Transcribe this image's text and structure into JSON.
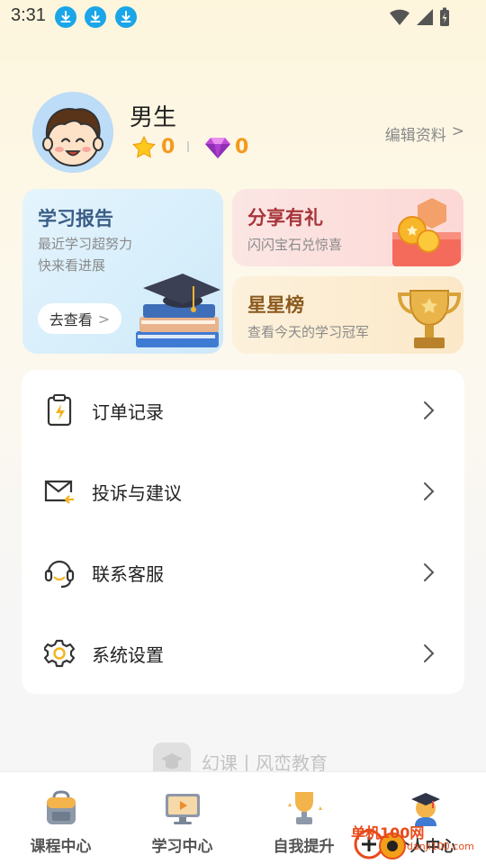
{
  "status_bar": {
    "time": "3:31"
  },
  "profile": {
    "name": "男生",
    "stars": "0",
    "gems": "0",
    "edit_label": "编辑资料",
    "edit_chevron": ">"
  },
  "cards": {
    "report": {
      "title": "学习报告",
      "line1": "最近学习超努力",
      "line2": "快来看进展",
      "button": "去查看",
      "button_chevron": ">",
      "title_color": "#3a5d86"
    },
    "share": {
      "title": "分享有礼",
      "subtitle": "闪闪宝石兑惊喜",
      "title_color": "#a8353a"
    },
    "stars": {
      "title": "星星榜",
      "subtitle": "查看今天的学习冠军",
      "title_color": "#8b5a1e"
    }
  },
  "menu": {
    "items": [
      {
        "label": "订单记录",
        "icon": "order-clipboard-icon"
      },
      {
        "label": "投诉与建议",
        "icon": "feedback-mail-icon"
      },
      {
        "label": "联系客服",
        "icon": "headset-icon"
      },
      {
        "label": "系统设置",
        "icon": "gear-icon"
      }
    ]
  },
  "brand": {
    "text": "幻课丨风峦教育"
  },
  "bottom_nav": {
    "items": [
      {
        "label": "课程中心",
        "icon": "backpack-icon"
      },
      {
        "label": "学习中心",
        "icon": "monitor-play-icon"
      },
      {
        "label": "自我提升",
        "icon": "trophy-icon"
      },
      {
        "label": "个人中心",
        "icon": "graduate-avatar-icon"
      }
    ]
  },
  "watermark": {
    "text": "单机100网",
    "sub": "danji100.com"
  },
  "colors": {
    "accent_orange": "#f39a1e",
    "status_blue": "#1aa6e8"
  }
}
